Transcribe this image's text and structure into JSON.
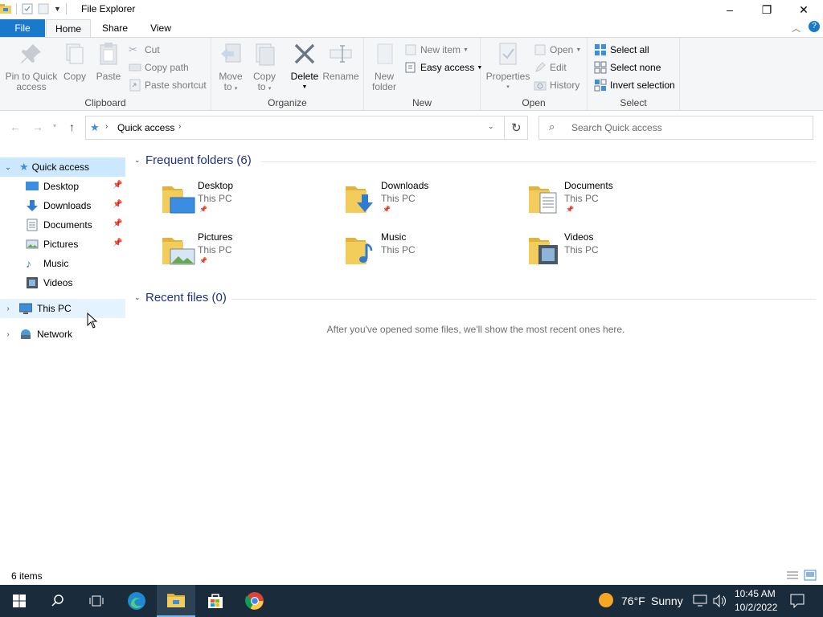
{
  "window": {
    "title": "File Explorer",
    "controls": {
      "minimize": "–",
      "maximize": "❐",
      "close": "✕"
    }
  },
  "tabs": {
    "file": "File",
    "home": "Home",
    "share": "Share",
    "view": "View"
  },
  "ribbon": {
    "clipboard": {
      "label": "Clipboard",
      "pin": "Pin to Quick access",
      "pin_line1": "Pin to Quick",
      "pin_line2": "access",
      "copy": "Copy",
      "paste": "Paste",
      "cut": "Cut",
      "copy_path": "Copy path",
      "paste_shortcut": "Paste shortcut"
    },
    "organize": {
      "label": "Organize",
      "move_to_line1": "Move",
      "move_to_line2": "to",
      "copy_to_line1": "Copy",
      "copy_to_line2": "to",
      "delete": "Delete",
      "rename": "Rename"
    },
    "new": {
      "label": "New",
      "new_folder_line1": "New",
      "new_folder_line2": "folder",
      "new_item": "New item",
      "easy_access": "Easy access"
    },
    "open": {
      "label": "Open",
      "properties": "Properties",
      "open": "Open",
      "edit": "Edit",
      "history": "History"
    },
    "select": {
      "label": "Select",
      "select_all": "Select all",
      "select_none": "Select none",
      "invert_selection": "Invert selection"
    }
  },
  "address": {
    "path": "Quick access",
    "search_placeholder": "Search Quick access"
  },
  "sidebar": {
    "quick_access": "Quick access",
    "items": [
      {
        "label": "Desktop",
        "pinned": true
      },
      {
        "label": "Downloads",
        "pinned": true
      },
      {
        "label": "Documents",
        "pinned": true
      },
      {
        "label": "Pictures",
        "pinned": true
      },
      {
        "label": "Music",
        "pinned": false
      },
      {
        "label": "Videos",
        "pinned": false
      }
    ],
    "this_pc": "This PC",
    "network": "Network"
  },
  "main": {
    "frequent_title": "Frequent folders (6)",
    "recent_title": "Recent files (0)",
    "recent_empty": "After you've opened some files, we'll show the most recent ones here.",
    "folders": [
      {
        "name": "Desktop",
        "location": "This PC",
        "pinned": true
      },
      {
        "name": "Downloads",
        "location": "This PC",
        "pinned": true
      },
      {
        "name": "Documents",
        "location": "This PC",
        "pinned": true
      },
      {
        "name": "Pictures",
        "location": "This PC",
        "pinned": true
      },
      {
        "name": "Music",
        "location": "This PC",
        "pinned": false
      },
      {
        "name": "Videos",
        "location": "This PC",
        "pinned": false
      }
    ]
  },
  "status": {
    "items": "6 items"
  },
  "taskbar": {
    "weather_temp": "76°F",
    "weather_cond": "Sunny",
    "time": "10:45 AM",
    "date": "10/2/2022"
  },
  "colors": {
    "accent": "#1979ca",
    "section_title": "#1e3287",
    "folder_yellow": "#f3cd5c",
    "taskbar": "#1a2b3c",
    "selected": "#cce8ff"
  }
}
